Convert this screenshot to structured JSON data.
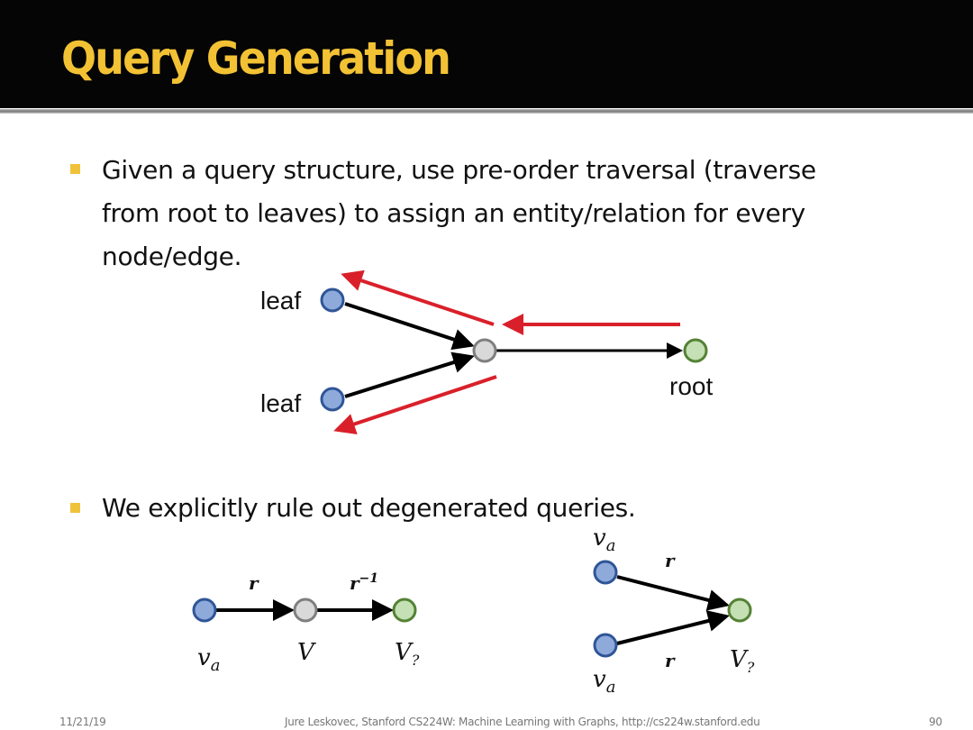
{
  "slide": {
    "title": "Query Generation",
    "bullets": [
      "Given a query structure, use pre-order traversal (traverse from root to leaves) to assign an entity/relation for every node/edge.",
      "We explicitly rule out degenerated queries."
    ],
    "bullet_lines": [
      [
        "Given a query structure, use pre-order traversal (traverse",
        "from root to leaves) to assign an entity/relation for every",
        "node/edge."
      ]
    ]
  },
  "diagram_top": {
    "leaf1": "leaf",
    "leaf2": "leaf",
    "root": "root"
  },
  "diagram_chain": {
    "edge1": "r",
    "edge2": "r",
    "edge2_sup": "−1",
    "node1": "v",
    "node1_sub": "a",
    "node2": "V",
    "node3": "V",
    "node3_sub": "?"
  },
  "diagram_fork": {
    "top_node": "v",
    "top_node_sub": "a",
    "bottom_node": "v",
    "bottom_node_sub": "a",
    "edge_top": "r",
    "edge_bottom": "r",
    "target": "V",
    "target_sub": "?"
  },
  "footer": {
    "date": "11/21/19",
    "center": "Jure Leskovec, Stanford CS224W: Machine Learning with Graphs, http://cs224w.stanford.edu",
    "page": "90"
  },
  "colors": {
    "title": "#f2c234",
    "red_arrow": "#d9202a",
    "leaf_fill": "#8eaadb",
    "leaf_stroke": "#2f5597",
    "mid_fill": "#d9d9d9",
    "mid_stroke": "#7f7f7f",
    "root_fill": "#c5e0b4",
    "root_stroke": "#548235"
  }
}
